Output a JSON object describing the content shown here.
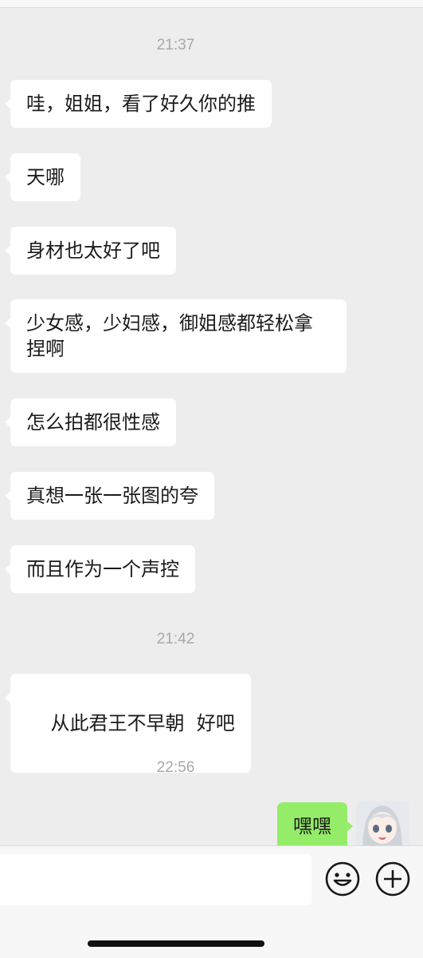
{
  "chat": {
    "messages": [
      {
        "kind": "time",
        "text": "21:37"
      },
      {
        "kind": "in",
        "text": "哇，姐姐，看了好久你的推"
      },
      {
        "kind": "in",
        "text": "天哪"
      },
      {
        "kind": "in",
        "text": "身材也太好了吧"
      },
      {
        "kind": "in",
        "text": "少女感，少妇感，御姐感都轻松拿捏啊"
      },
      {
        "kind": "in",
        "text": "怎么拍都很性感"
      },
      {
        "kind": "in",
        "text": "真想一张一张图的夸"
      },
      {
        "kind": "in",
        "text": "而且作为一个声控"
      },
      {
        "kind": "time",
        "text": "21:42"
      },
      {
        "kind": "in",
        "text": "从此君王不早朝  好吧"
      },
      {
        "kind": "time",
        "text": "22:56"
      },
      {
        "kind": "out",
        "text": "嘿嘿"
      }
    ]
  },
  "input": {
    "placeholder": "",
    "emoji_icon": "emoji-icon",
    "plus_icon": "plus-circle-icon"
  },
  "colors": {
    "background": "#ededed",
    "incoming_bubble": "#ffffff",
    "outgoing_bubble": "#95ec69",
    "timestamp": "#a9a9a9"
  }
}
